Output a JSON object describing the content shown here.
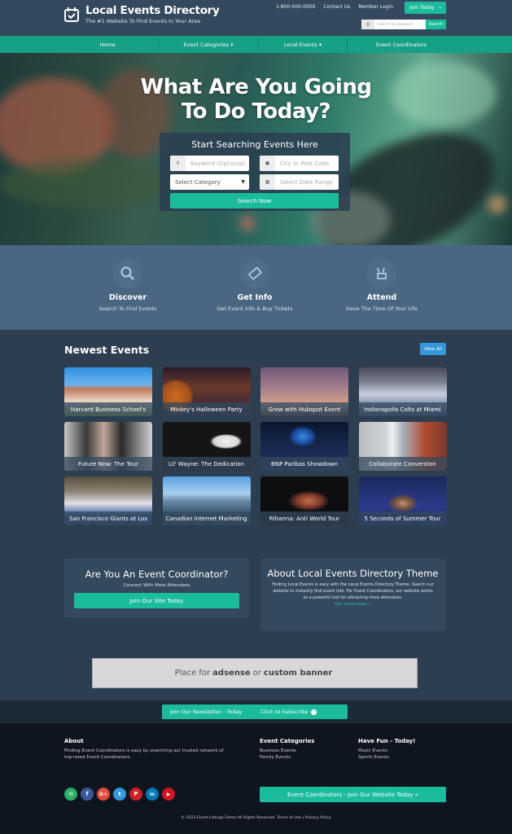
{
  "header": {
    "title": "Local Events Directory",
    "tagline": "The #1 Website To Find Events In Your Area",
    "phone": "1-800-000-0000",
    "contact": "Contact Us",
    "login": "Member Login",
    "join": "Join Today",
    "search_placeholder": "Search by Keyword",
    "search_button": "Search"
  },
  "nav": {
    "items": [
      {
        "label": "Home"
      },
      {
        "label": "Event Categories ▾"
      },
      {
        "label": "Local Events ▾"
      },
      {
        "label": "Event Coordinators"
      }
    ]
  },
  "hero": {
    "title_line1": "What Are You Going",
    "title_line2": "To Do Today?",
    "search_title": "Start Searching Events Here",
    "keyword_placeholder": "Keyword (Optional)",
    "location_placeholder": "City or Post Code",
    "category_value": "Select Category",
    "date_placeholder": "Select Date Range",
    "search_button": "Search Now"
  },
  "features": [
    {
      "title": "Discover",
      "subtitle": "Search To Find Events",
      "icon": "search-icon"
    },
    {
      "title": "Get Info",
      "subtitle": "Get Event Info & Buy Tickets",
      "icon": "ticket-icon"
    },
    {
      "title": "Attend",
      "subtitle": "Have The Time Of Your Life",
      "icon": "peace-hand-icon"
    }
  ],
  "events": {
    "heading": "Newest Events",
    "view_all": "View All",
    "items": [
      {
        "title": "Harvard Business School's"
      },
      {
        "title": "Mickey's Halloween Party"
      },
      {
        "title": "Grow with Hubspot Event"
      },
      {
        "title": "Indianapolis Colts at Miami"
      },
      {
        "title": "Future Now: The Tour"
      },
      {
        "title": "Lil' Wayne: The Dedication"
      },
      {
        "title": "BNP Paribas Showdown"
      },
      {
        "title": "Collaborate Convention"
      },
      {
        "title": "San Francisco Giants at Los"
      },
      {
        "title": "Canadian Internet Marketing"
      },
      {
        "title": "Rihanna: Anti World Tour"
      },
      {
        "title": "5 Seconds of Summer Tour"
      }
    ]
  },
  "coordinator": {
    "title": "Are You An Event Coordinator?",
    "subtitle": "Connect With More Attendees",
    "button": "Join Our Site Today"
  },
  "about": {
    "title": "About Local Events Directory Theme",
    "text": "Finding Local Events is easy with the Local Events Directory Theme. Search our website to instantly find event info. For Event Coordinators, our website works as a powerful tool for attracting more attendees.",
    "link": "Get listed today »"
  },
  "ad": {
    "prefix": "Place for",
    "bold1": "adsense",
    "middle": "or",
    "bold2": "custom banner"
  },
  "newsletter": {
    "label": "Join Our Newsletter - Today",
    "button": "Click to Subscribe"
  },
  "footer": {
    "about_title": "About",
    "about_text": "Finding Event Coordinators is easy by searching our trusted network of top-rated Event Coordinators.",
    "categories_title": "Event Categories",
    "categories": [
      "Business Events",
      "Family Events"
    ],
    "fun_title": "Have Fun - Today!",
    "fun_links": [
      "Music Events",
      "Sports Events"
    ],
    "social": [
      {
        "name": "email",
        "glyph": "✉",
        "color": "#27ae60"
      },
      {
        "name": "facebook",
        "glyph": "f",
        "color": "#3b5998"
      },
      {
        "name": "google-plus",
        "glyph": "G+",
        "color": "#dd4b39"
      },
      {
        "name": "twitter",
        "glyph": "t",
        "color": "#3498db"
      },
      {
        "name": "pinterest",
        "glyph": "P",
        "color": "#cb2027"
      },
      {
        "name": "linkedin",
        "glyph": "in",
        "color": "#0077b5"
      },
      {
        "name": "youtube",
        "glyph": "▶",
        "color": "#cc181e"
      }
    ],
    "join_button": "Event Coordinators - Join Our Website Today »",
    "copyright": "© 2023 Event Listings Demo All Rights Reserved.",
    "terms": "Terms of Use",
    "privacy": "Privacy Policy"
  },
  "colors": {
    "accent": "#1abc9c",
    "nav": "#16a085",
    "header": "#34495e",
    "view_all": "#3498db"
  }
}
